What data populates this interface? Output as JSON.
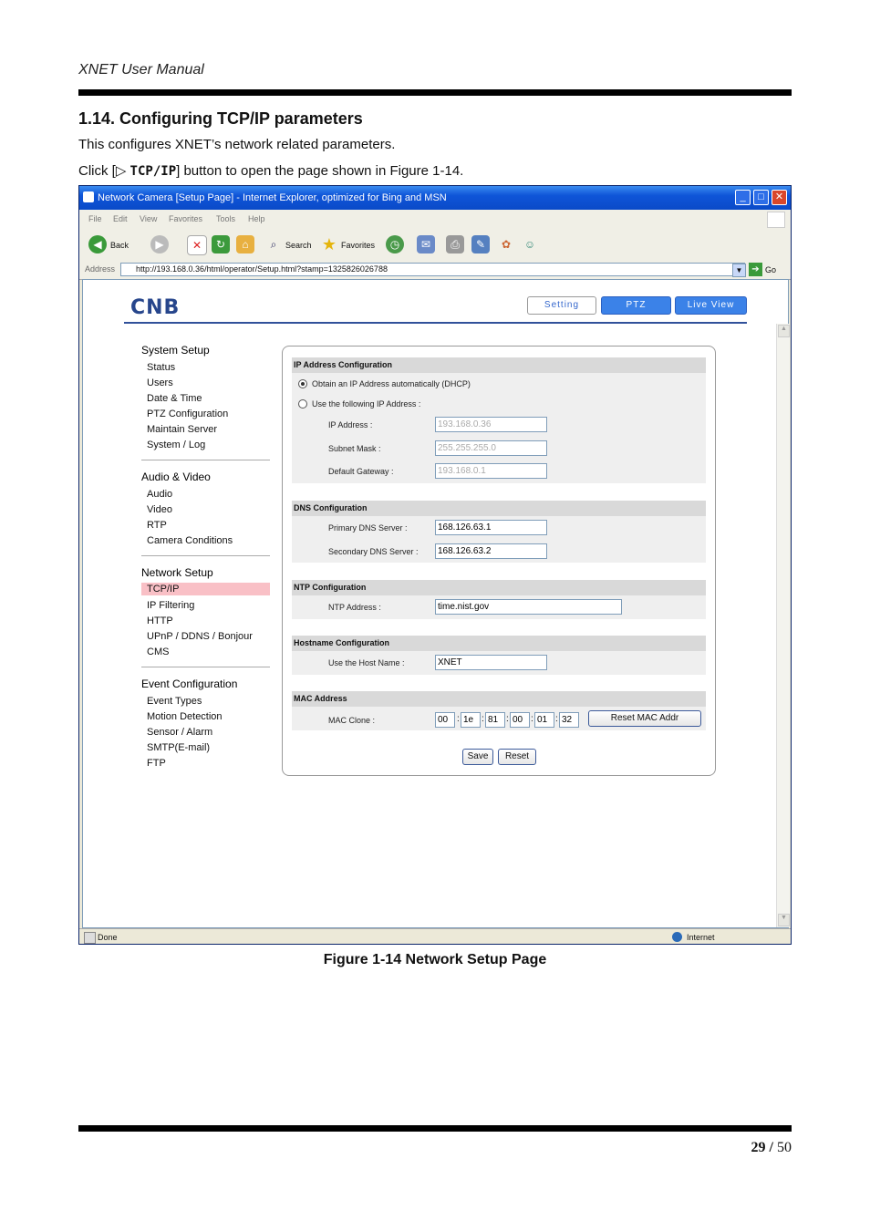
{
  "document": {
    "header": "XNET User Manual",
    "section_title": "1.14. Configuring TCP/IP parameters",
    "intro": "This configures XNET’s network related parameters.",
    "click_prefix": "Click [▷ ",
    "click_button": "TCP/IP",
    "click_suffix": "] button to open the page shown in Figure 1-14.",
    "caption": "Figure 1-14 Network Setup Page",
    "page_current": "29",
    "page_sep": " / ",
    "page_total": "50"
  },
  "browser": {
    "title": "Network Camera [Setup Page] - Internet Explorer, optimized for Bing and MSN",
    "menu": [
      "File",
      "Edit",
      "View",
      "Favorites",
      "Tools",
      "Help"
    ],
    "back_label": "Back",
    "search_label": "Search",
    "favorites_label": "Favorites",
    "address_label": "Address",
    "url": "http://193.168.0.36/html/operator/Setup.html?stamp=1325826026788",
    "go_label": "Go",
    "status_text": "Done",
    "zone_text": "Internet"
  },
  "app": {
    "logo": "CNB",
    "nav": {
      "setting": "Setting",
      "ptz": "PTZ",
      "live_view": "Live View"
    },
    "sidebar": {
      "system_setup": {
        "title": "System Setup",
        "items": [
          "Status",
          "Users",
          "Date & Time",
          "PTZ Configuration",
          "Maintain Server",
          "System / Log"
        ]
      },
      "audio_video": {
        "title": "Audio & Video",
        "items": [
          "Audio",
          "Video",
          "RTP",
          "Camera Conditions"
        ]
      },
      "network_setup": {
        "title": "Network Setup",
        "items": [
          "TCP/IP",
          "IP Filtering",
          "HTTP",
          "UPnP / DDNS / Bonjour",
          "CMS"
        ]
      },
      "event_config": {
        "title": "Event Configuration",
        "items": [
          "Event Types",
          "Motion Detection",
          "Sensor / Alarm",
          "SMTP(E-mail)",
          "FTP"
        ]
      }
    },
    "ip": {
      "header": "IP Address Configuration",
      "dhcp_label": "Obtain an IP Address automatically (DHCP)",
      "static_label": "Use the following IP Address :",
      "dhcp_selected": true,
      "ip_label": "IP Address :",
      "ip_value": "193.168.0.36",
      "mask_label": "Subnet Mask :",
      "mask_value": "255.255.255.0",
      "gateway_label": "Default Gateway :",
      "gateway_value": "193.168.0.1"
    },
    "dns": {
      "header": "DNS Configuration",
      "primary_label": "Primary DNS Server :",
      "primary_value": "168.126.63.1",
      "secondary_label": "Secondary DNS Server :",
      "secondary_value": "168.126.63.2"
    },
    "ntp": {
      "header": "NTP Configuration",
      "address_label": "NTP Address :",
      "address_value": "time.nist.gov"
    },
    "hostname": {
      "header": "Hostname Configuration",
      "label": "Use the Host Name :",
      "value": "XNET"
    },
    "mac": {
      "header": "MAC Address",
      "label": "MAC Clone :",
      "octets": [
        "00",
        "1e",
        "81",
        "00",
        "01",
        "32"
      ],
      "reset_label": "Reset MAC Addr"
    },
    "save_label": "Save",
    "reset_label": "Reset"
  }
}
